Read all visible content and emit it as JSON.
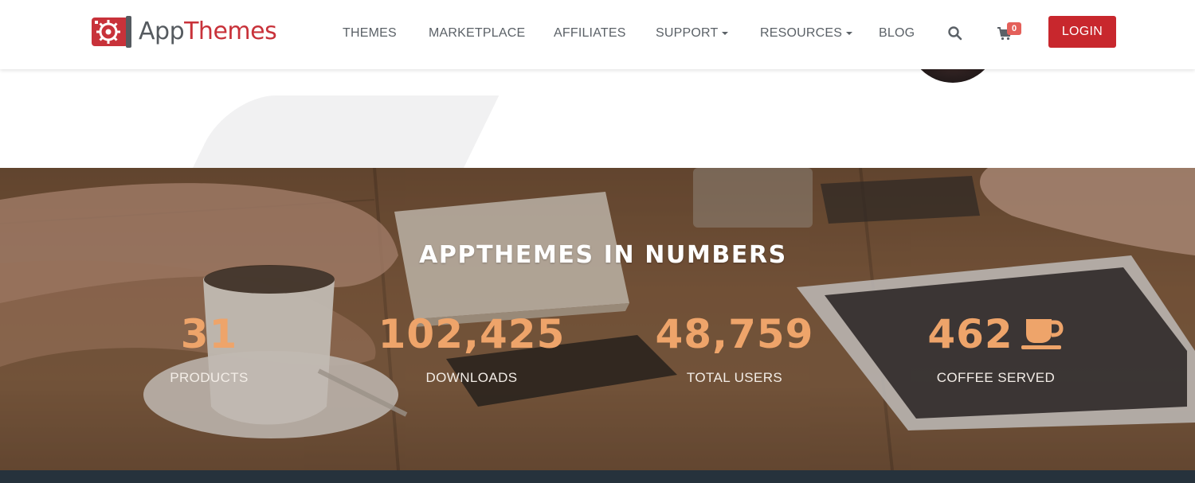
{
  "header": {
    "logo": {
      "app": "App",
      "themes": "Themes"
    },
    "nav": {
      "themes": "THEMES",
      "marketplace": "MARKETPLACE",
      "affiliates": "AFFILIATES",
      "support": "SUPPORT",
      "resources": "RESOURCES",
      "blog": "BLOG"
    },
    "cart_count": "0",
    "login_label": "LOGIN"
  },
  "stats_section": {
    "title": "APPTHEMES IN NUMBERS",
    "items": [
      {
        "value": "31",
        "label": "PRODUCTS"
      },
      {
        "value": "102,425",
        "label": "DOWNLOADS"
      },
      {
        "value": "48,759",
        "label": "TOTAL USERS"
      },
      {
        "value": "462",
        "label": "COFFEE SERVED",
        "icon": "coffee-icon"
      }
    ]
  },
  "colors": {
    "brand_red": "#c8272d",
    "stat_orange": "#eea46a",
    "nav_text": "#5b6167",
    "cart_badge": "#e4605a",
    "footer": "#26323c"
  },
  "icons": [
    "search-icon",
    "cart-icon",
    "coffee-icon",
    "caret-down-icon",
    "logo-icon"
  ]
}
